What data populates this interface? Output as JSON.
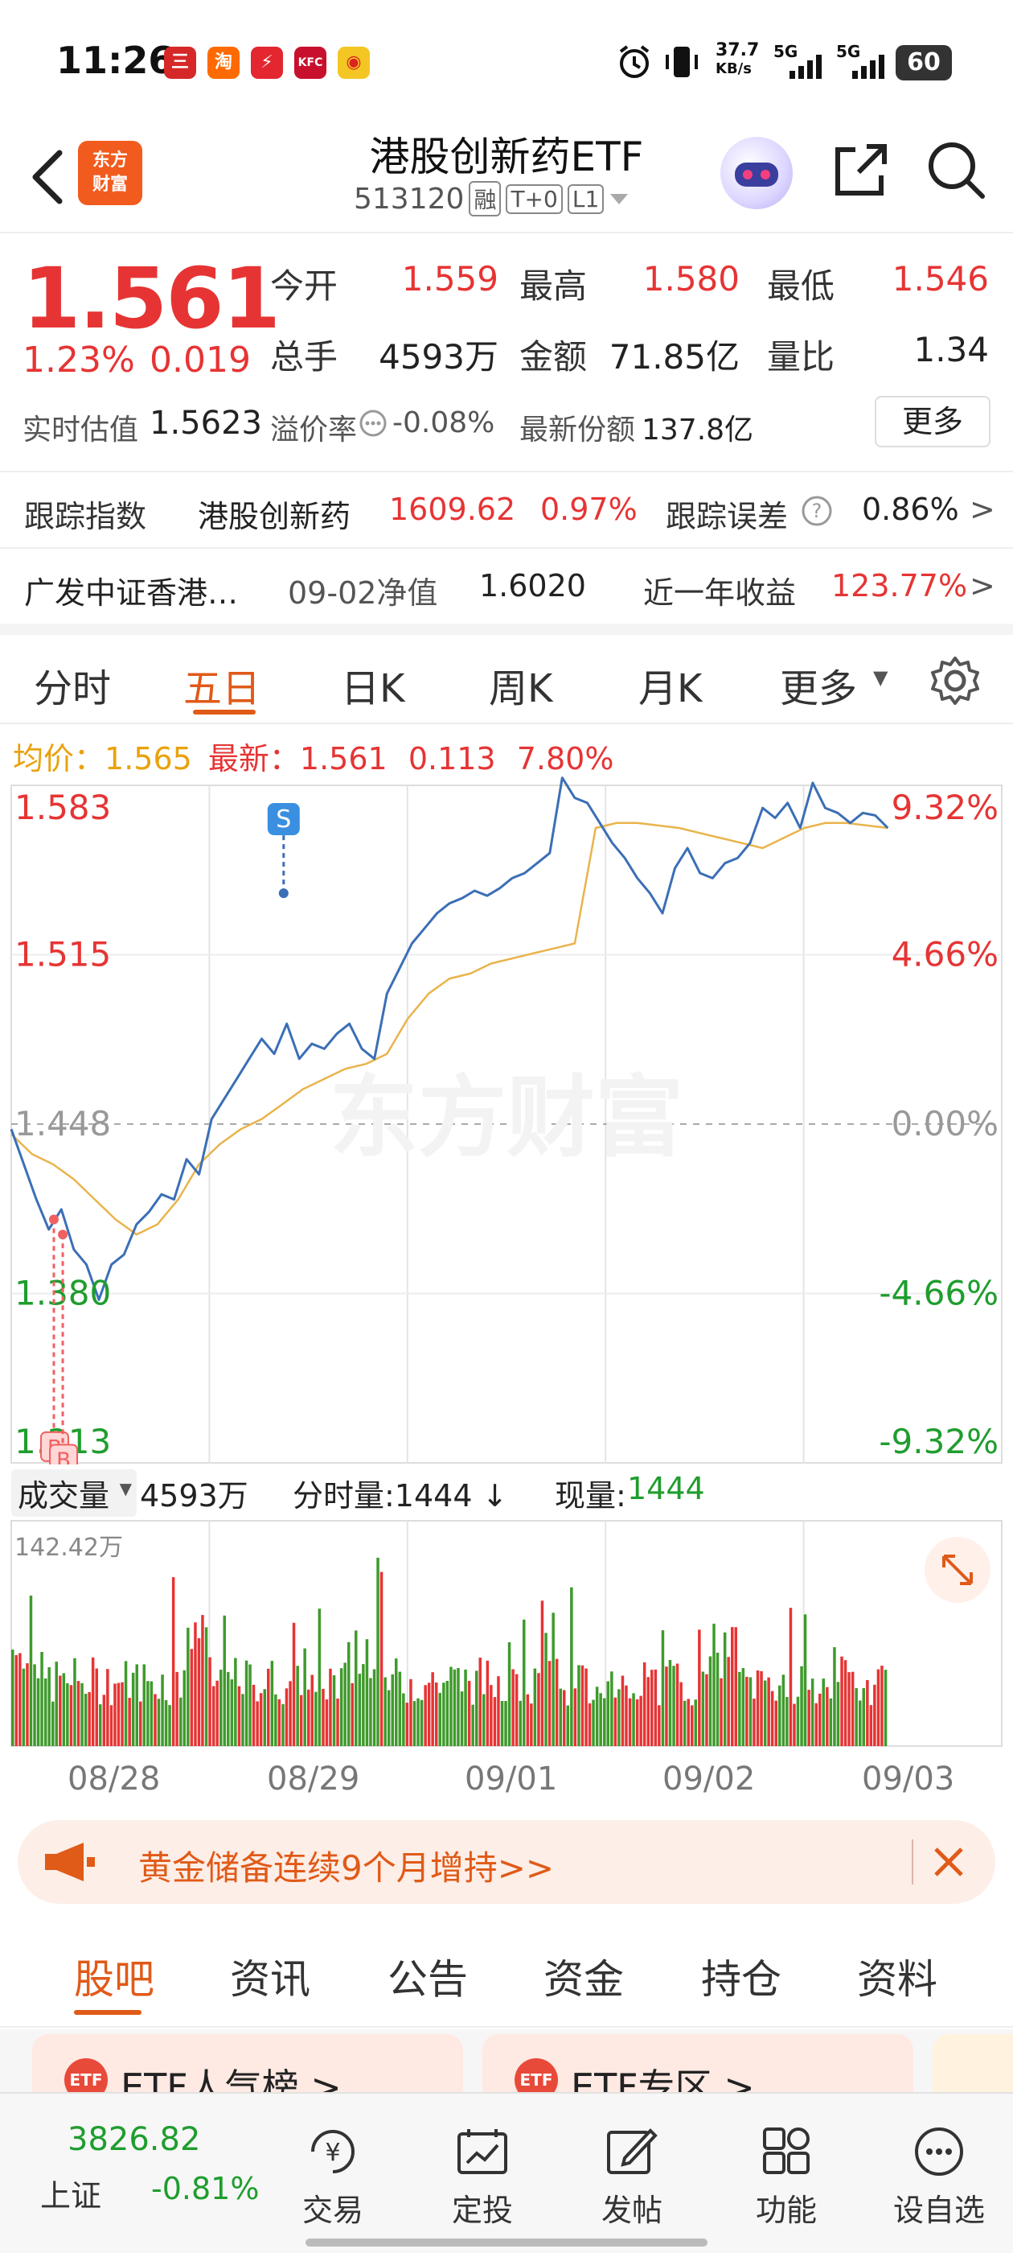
{
  "status_bar": {
    "time": "11:26",
    "speed": "37.7",
    "speed_unit": "KB/s",
    "net1": "5G",
    "net2": "5G",
    "battery": "60"
  },
  "header": {
    "logo_line1": "东方",
    "logo_line2": "财富",
    "title": "港股创新药ETF",
    "code": "513120",
    "tags": [
      "融",
      "T+0",
      "L1"
    ]
  },
  "quote": {
    "price": "1.561",
    "change_pct": "1.23%",
    "change_amt": "0.019",
    "open_label": "今开",
    "open": "1.559",
    "high_label": "最高",
    "high": "1.580",
    "low_label": "最低",
    "low": "1.546",
    "vol_label": "总手",
    "vol": "4593万",
    "amount_label": "金额",
    "amount": "71.85亿",
    "ratio_label": "量比",
    "ratio": "1.34",
    "est_label": "实时估值",
    "est": "1.5623",
    "premium_label": "溢价率",
    "premium": "-0.08%",
    "shares_label": "最新份额",
    "shares": "137.8亿",
    "more_label": "更多"
  },
  "tracking": {
    "label": "跟踪指数",
    "index_name": "港股创新药",
    "index_value": "1609.62",
    "index_chg": "0.97%",
    "error_label": "跟踪误差",
    "error_value": "0.86%"
  },
  "fund": {
    "name": "广发中证香港…",
    "nav_label": "09-02净值",
    "nav_value": "1.6020",
    "return_label": "近一年收益",
    "return_value": "123.77%"
  },
  "chart_tabs": [
    "分时",
    "五日",
    "日K",
    "周K",
    "月K",
    "更多"
  ],
  "chart_info": {
    "avg_label": "均价：",
    "avg_value": "1.565",
    "latest_label": "最新：",
    "latest_value": "1.561",
    "latest_chg": "0.113",
    "latest_pct": "7.80%"
  },
  "chart_data": {
    "type": "line",
    "y_left_labels": [
      "1.583",
      "1.515",
      "1.448",
      "1.380",
      "1.313"
    ],
    "y_right_labels": [
      "9.32%",
      "4.66%",
      "0.00%",
      "-4.66%",
      "-9.32%"
    ],
    "x_labels": [
      "08/28",
      "08/29",
      "09/01",
      "09/02",
      "09/03"
    ],
    "ylim": [
      1.313,
      1.583
    ],
    "watermark": "东方财富",
    "markers": [
      "S",
      "B",
      "B"
    ],
    "series": [
      {
        "name": "最新",
        "color": "#3b6fb6",
        "values": [
          1.446,
          1.432,
          1.418,
          1.406,
          1.414,
          1.398,
          1.392,
          1.378,
          1.392,
          1.396,
          1.408,
          1.413,
          1.42,
          1.418,
          1.434,
          1.428,
          1.45,
          1.458,
          1.466,
          1.474,
          1.482,
          1.476,
          1.488,
          1.474,
          1.48,
          1.478,
          1.484,
          1.488,
          1.478,
          1.474,
          1.5,
          1.51,
          1.52,
          1.526,
          1.532,
          1.536,
          1.538,
          1.541,
          1.539,
          1.542,
          1.546,
          1.548,
          1.552,
          1.556,
          1.586,
          1.578,
          1.576,
          1.568,
          1.56,
          1.554,
          1.546,
          1.54,
          1.532,
          1.55,
          1.558,
          1.548,
          1.546,
          1.552,
          1.554,
          1.56,
          1.574,
          1.57,
          1.576,
          1.566,
          1.584,
          1.574,
          1.572,
          1.568,
          1.572,
          1.571,
          1.566
        ]
      },
      {
        "name": "均价",
        "color": "#e9b44c",
        "values": [
          1.444,
          1.436,
          1.432,
          1.426,
          1.418,
          1.41,
          1.404,
          1.408,
          1.418,
          1.432,
          1.44,
          1.446,
          1.45,
          1.456,
          1.462,
          1.466,
          1.47,
          1.472,
          1.476,
          1.49,
          1.5,
          1.506,
          1.508,
          1.512,
          1.514,
          1.516,
          1.518,
          1.52,
          1.566,
          1.568,
          1.568,
          1.567,
          1.566,
          1.564,
          1.562,
          1.56,
          1.558,
          1.562,
          1.566,
          1.568,
          1.568,
          1.567,
          1.566
        ]
      }
    ]
  },
  "volume": {
    "label": "成交量",
    "total": "4593万",
    "tick_label": "分时量:1444 ↓",
    "now_label": "现量:",
    "now_value": "1444",
    "max_label": "142.42万"
  },
  "banner": {
    "text": "黄金储备连续9个月增持>>"
  },
  "community_tabs": [
    "股吧",
    "资讯",
    "公告",
    "资金",
    "持仓",
    "资料"
  ],
  "cards": [
    {
      "badge": "ETF",
      "title": "ETF人气榜 >"
    },
    {
      "badge": "ETF",
      "title": "ETF专区 >"
    }
  ],
  "bottom_nav": {
    "index_value": "3826.82",
    "index_name": "上证",
    "index_chg": "-0.81%",
    "items": [
      "交易",
      "定投",
      "发帖",
      "功能",
      "设自选"
    ]
  }
}
